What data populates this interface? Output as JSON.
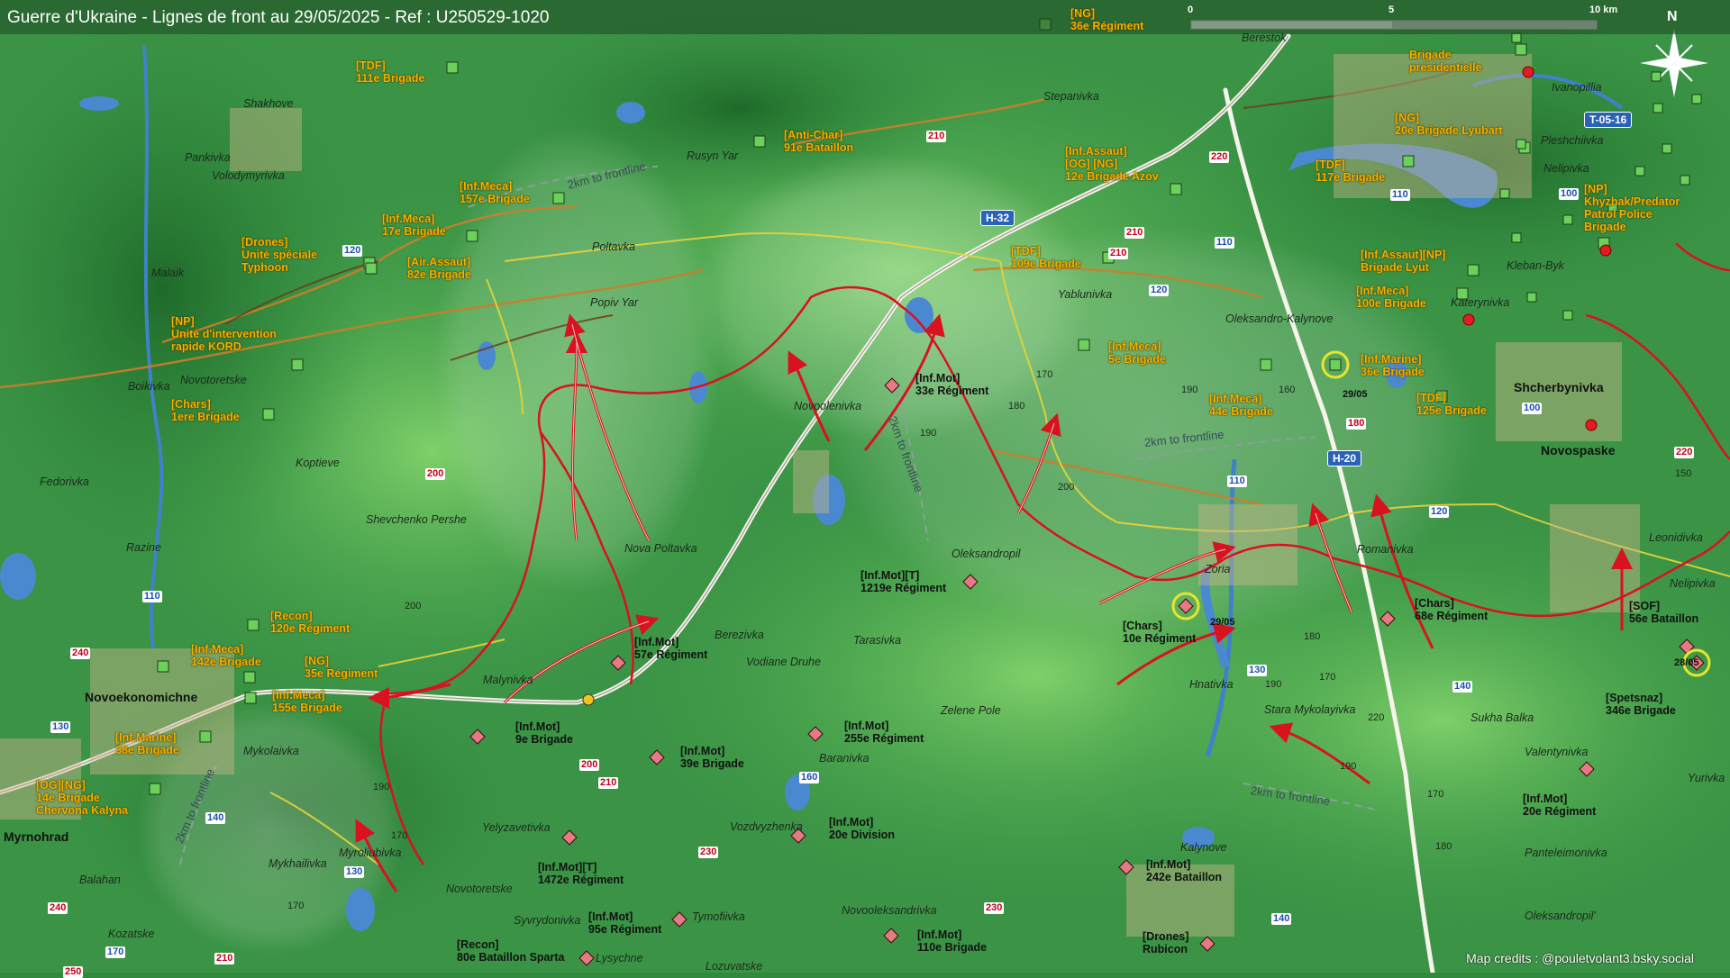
{
  "title": "Guerre d'Ukraine - Lignes de front au 29/05/2025 - Ref : U250529-1020",
  "credits": "Map credits : @pouletvolant3.bsky.social",
  "scale": {
    "labels": [
      "0",
      "5",
      "10 km"
    ]
  },
  "north": "N",
  "colors": {
    "ukraine_units": "#f3b300",
    "russia_units": "#e57a85",
    "frontline": "#d8121f",
    "background": "#2f8a3c"
  },
  "places": [
    "Shakhove",
    "Pankivka",
    "Volodymyrivka",
    "Malaik",
    "Novotoretske",
    "Boikivka",
    "Fedorivka",
    "Koptieve",
    "Razine",
    "Shevchenko Pershe",
    "Novoekonomichne",
    "Mykolaivka",
    "Myrnohrad",
    "Balahan",
    "Kozatske",
    "Mykhailivka",
    "Myroliubivka",
    "Novotoretske",
    "Yelyzavetivka",
    "Syvrydonivka",
    "Lysychne",
    "Tymofiivka",
    "Lozuvatske",
    "Malynivka",
    "Nova Poltavka",
    "Berezivka",
    "Vodiane Druhe",
    "Popiv Yar",
    "Poltavka",
    "Rusyn Yar",
    "Stepanivka",
    "Berestok",
    "Novoolenivka",
    "Oleksandropil",
    "Tarasivka",
    "Zelene Pole",
    "Baranivka",
    "Vozdvyzhenka",
    "Novooleksandrivka",
    "Yablunivka",
    "Oleksandro-Kalynove",
    "Zoria",
    "Hnativka",
    "Stara Mykolayivka",
    "Romanivka",
    "Kalynove",
    "Sukha Balka",
    "Valentynivka",
    "Panteleimonivka",
    "Oleksandropil'",
    "Yurivka",
    "Leonidivka",
    "Nelipivka",
    "Shcherbynivka",
    "Novospaske",
    "Ivanopillia",
    "Pleshchiivka",
    "Nelipivka",
    "Kleban-Byk",
    "Katerynivka"
  ],
  "ua_units": [
    {
      "label": "[TDF]\n111e Brigade"
    },
    {
      "label": "[Inf.Meca]\n157e Brigade"
    },
    {
      "label": "[Inf.Meca]\n17e Brigade"
    },
    {
      "label": "[Drones]\nUnité spéciale\nTyphoon"
    },
    {
      "label": "[Air.Assaut]\n82e Brigade"
    },
    {
      "label": "[NP]\nUnité d'intervention\nrapide KORD"
    },
    {
      "label": "[Chars]\n1ere Brigade"
    },
    {
      "label": "[Anti-Char]\n91e Bataillon"
    },
    {
      "label": "[NG]\n36e Régiment"
    },
    {
      "label": "[Inf.Assaut]\n[OG] [NG]\n12e Brigade Azov"
    },
    {
      "label": "[TDF]\n109e Brigade"
    },
    {
      "label": "[Inf.Meca]\n5e Brigade"
    },
    {
      "label": "[Inf.Meca]\n44e Brigade"
    },
    {
      "label": "[Inf.Marine]\n36e Brigade"
    },
    {
      "label": "[TDF]\n117e Brigade"
    },
    {
      "label": "Brigade\nprésidentielle"
    },
    {
      "label": "[NG]\n20e Brigade Lyubart"
    },
    {
      "label": "[NP]\nKhyzhak/Predator\nPatrol Police\nBrigade"
    },
    {
      "label": "[Inf.Assaut][NP]\nBrigade Lyut"
    },
    {
      "label": "[Inf.Meca]\n100e Brigade"
    },
    {
      "label": "[TDF]\n125e Brigade"
    },
    {
      "label": "[Recon]\n120e Régiment"
    },
    {
      "label": "[Inf.Meca]\n142e Brigade"
    },
    {
      "label": "[NG]\n35e Régiment"
    },
    {
      "label": "[Inf.Meca]\n155e Brigade"
    },
    {
      "label": "[Inf.Marine]\n38e Brigade"
    },
    {
      "label": "[OG][NG]\n14e Brigade\nChervona Kalyna"
    }
  ],
  "ru_units": [
    {
      "label": "[Inf.Mot]\n33e Régiment"
    },
    {
      "label": "[Inf.Mot][T]\n1219e Régiment"
    },
    {
      "label": "[Inf.Mot]\n57e Régiment"
    },
    {
      "label": "[Inf.Mot]\n9e Brigade"
    },
    {
      "label": "[Inf.Mot]\n39e Brigade"
    },
    {
      "label": "[Inf.Mot]\n255e Régiment"
    },
    {
      "label": "[Inf.Mot]\n20e Division"
    },
    {
      "label": "[Inf.Mot][T]\n1472e Régiment"
    },
    {
      "label": "[Inf.Mot]\n95e Régiment"
    },
    {
      "label": "[Recon]\n80e Bataillon Sparta"
    },
    {
      "label": "[Inf.Mot]\n110e Brigade"
    },
    {
      "label": "[Chars]\n10e Régiment"
    },
    {
      "label": "[Chars]\n68e Régiment"
    },
    {
      "label": "[Inf.Mot]\n242e Bataillon"
    },
    {
      "label": "[Drones]\nRubicon"
    },
    {
      "label": "[SOF]\n56e Bataillon"
    },
    {
      "label": "[Spetsnaz]\n346e Brigade"
    },
    {
      "label": "[Inf.Mot]\n20e Régiment"
    }
  ],
  "roads": [
    "H-32",
    "H-20",
    "T-05-16"
  ],
  "road_numbers": {
    "red": [
      "210",
      "220",
      "210",
      "180",
      "200",
      "200",
      "210",
      "220",
      "240",
      "250",
      "230",
      "230",
      "210",
      "240",
      "210"
    ],
    "blue": [
      "120",
      "110",
      "120",
      "110",
      "130",
      "140",
      "110",
      "120",
      "100",
      "100",
      "110",
      "130",
      "140",
      "160",
      "140",
      "170",
      "130"
    ]
  },
  "altitudes": [
    "170",
    "190",
    "160",
    "180",
    "200",
    "200",
    "150",
    "180",
    "190",
    "170",
    "220",
    "190",
    "180",
    "170",
    "190",
    "190",
    "170",
    "170"
  ],
  "frontline_labels": [
    "2km to frontline",
    "2km to frontline",
    "2km to frontline",
    "2km to frontline",
    "2km to frontline"
  ],
  "dates": [
    "29/05",
    "29/05",
    "28/05"
  ]
}
